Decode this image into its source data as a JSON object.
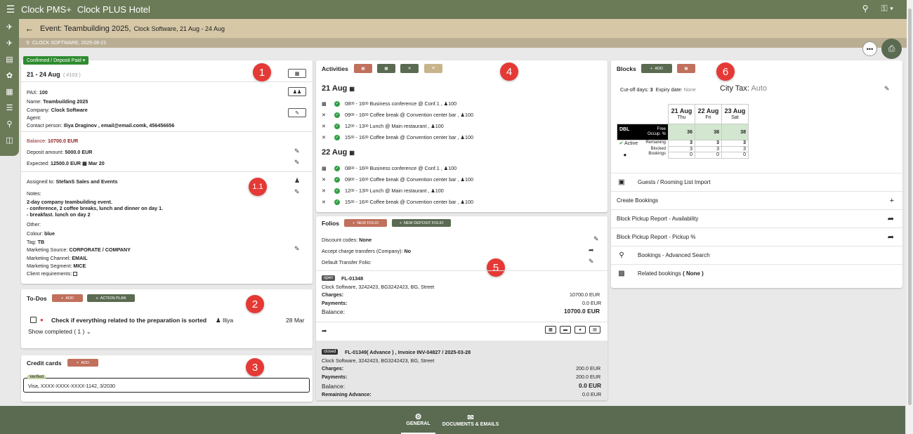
{
  "topbar": {
    "app_name": "Clock PMS+",
    "hotel_name": "Clock PLUS Hotel"
  },
  "event": {
    "title": "Event: Teambuilding 2025,",
    "subtitle": "Clock Software, 21 Aug - 24 Aug",
    "search_text": "CLOCK SOFTWARE, 2025-08-21"
  },
  "details": {
    "status": "Confirmed / Deposit Paid",
    "dates": "21 - 24 Aug",
    "ref": "( #103 )",
    "pax_label": "PAX:",
    "pax": "100",
    "name_label": "Name:",
    "name": "Teambuilding 2025",
    "company_label": "Company:",
    "company": "Clock Software",
    "agent_label": "Agent:",
    "contact_label": "Contact person:",
    "contact": "Iliya Draginov , email@email.comk, 456456656",
    "balance_label": "Balance:",
    "balance": "10700.0 EUR",
    "deposit_label": "Deposit amount:",
    "deposit": "5000.0 EUR",
    "expected_label": "Expected:",
    "expected": "12500.0 EUR",
    "expected_date": "Mar 20",
    "assigned_label": "Assigned to:",
    "assigned": "StefanS  Sales and Events",
    "notes_label": "Notes:",
    "notes_1": "2-day company teambuilding event.",
    "notes_2": "- conference, 2 coffee breaks, lunch and dinner on day 1.",
    "notes_3": "- breakfast. lunch on day 2",
    "other_label": "Other:",
    "colour_label": "Colour:",
    "colour": "blue",
    "tag_label": "Tag:",
    "tag": "TB",
    "msource_label": "Marketing Source:",
    "msource": "CORPORATE / COMPANY",
    "mchannel_label": "Marketing Channel:",
    "mchannel": "EMAIL",
    "msegment_label": "Marketing Segment:",
    "msegment": "MICE",
    "client_req_label": "Client requirements:"
  },
  "badges": {
    "b1": "1",
    "b11": "1.1",
    "b2": "2",
    "b3": "3",
    "b4": "4",
    "b5": "5",
    "b6": "6"
  },
  "todos": {
    "title": "To-Dos",
    "add": "ADD",
    "action_plan": "ACTION PLAN",
    "item": "Check if everything related to the preparation is sorted",
    "user": "Iliya",
    "date": "28 Mar",
    "show_completed": "Show completed ( 1 )"
  },
  "credit_cards": {
    "title": "Credit cards",
    "add": "ADD",
    "verified": "Verified",
    "card": "Visa, XXXX-XXXX-XXXX-1142, 3/2030"
  },
  "activities": {
    "title": "Activities",
    "days": [
      {
        "label": "21 Aug",
        "items": [
          {
            "t1": "08",
            "t2": "00",
            "t3": "16",
            "t4": "00",
            "desc": "Business conference @ Conf.1 ,",
            "pax": "100"
          },
          {
            "t1": "09",
            "t2": "00",
            "t3": "16",
            "t4": "00",
            "desc": "Coffee break @ Convention center bar ,",
            "pax": "100"
          },
          {
            "t1": "12",
            "t2": "00",
            "t3": "13",
            "t4": "00",
            "desc": "Lunch @ Main restaurant ,",
            "pax": "100"
          },
          {
            "t1": "15",
            "t2": "30",
            "t3": "16",
            "t4": "30",
            "desc": "Coffee break @ Convention center bar ,",
            "pax": "100"
          }
        ]
      },
      {
        "label": "22 Aug",
        "items": [
          {
            "t1": "08",
            "t2": "00",
            "t3": "16",
            "t4": "00",
            "desc": "Business conference @ Conf.1 ,",
            "pax": "100"
          },
          {
            "t1": "09",
            "t2": "00",
            "t3": "16",
            "t4": "00",
            "desc": "Coffee break @ Convention center bar ,",
            "pax": "100"
          },
          {
            "t1": "12",
            "t2": "00",
            "t3": "13",
            "t4": "00",
            "desc": "Lunch @ Main restaurant ,",
            "pax": "100"
          },
          {
            "t1": "15",
            "t2": "30",
            "t3": "16",
            "t4": "30",
            "desc": "Coffee break @ Convention center bar ,",
            "pax": "100"
          }
        ]
      }
    ]
  },
  "folios": {
    "title": "Folios",
    "new_folio": "NEW FOLIO",
    "new_deposit_folio": "NEW DEPOSIT FOLIO",
    "discount_label": "Discount codes:",
    "discount": "None",
    "accept_label": "Accept charge transfers (Company):",
    "accept": "No",
    "default_transfer_label": "Default Transfer Folio:",
    "f1": {
      "tag": "open",
      "id": "FL-01348",
      "address": "Clock Software, 3242423, BG3242423, BG, Street",
      "charges_label": "Charges:",
      "charges": "10700.0 EUR",
      "payments_label": "Payments:",
      "payments": "0.0 EUR",
      "balance_label": "Balance:",
      "balance": "10700.0 EUR"
    },
    "f2": {
      "tag": "closed",
      "id": "FL-01349( Advance ) , Invoice INV-04827 / 2025-03-28",
      "address": "Clock Software, 3242423, BG3242423, BG, Street",
      "charges_label": "Charges:",
      "charges": "200.0 EUR",
      "payments_label": "Payments:",
      "payments": "200.0 EUR",
      "balance_label": "Balance:",
      "balance": "0.0 EUR",
      "remaining_label": "Remaining Advance:",
      "remaining": "0.0 EUR"
    }
  },
  "blocks": {
    "title": "Blocks",
    "add": "ADD",
    "cutoff_label": "Cut-off days:",
    "cutoff": "3",
    "expiry_label": "Expiry date:",
    "expiry": "None",
    "city_tax_label": "City Tax:",
    "city_tax": "Auto",
    "dates": [
      {
        "d": "21 Aug",
        "w": "Thu"
      },
      {
        "d": "22 Aug",
        "w": "Fri"
      },
      {
        "d": "23 Aug",
        "w": "Sat"
      }
    ],
    "room_type": "DBL",
    "free_label": "Free",
    "occup_label": "Occup. %",
    "free": [
      "36",
      "38",
      "38"
    ],
    "active_label": "Active",
    "remaining_label": "Remaining",
    "blocked_label": "Blocked",
    "bookings_label": "Bookings",
    "remaining": [
      "3",
      "3",
      "3"
    ],
    "blocked": [
      "3",
      "3",
      "3"
    ],
    "bookings": [
      "0",
      "0",
      "0"
    ]
  },
  "right_menu": [
    {
      "label": "Guests / Rooming List Import"
    },
    {
      "label": "Create Bookings"
    },
    {
      "label": "Block Pickup Report - Availability"
    },
    {
      "label": "Block Pickup Report - Pickup %"
    },
    {
      "label": "Bookings - Advanced Search"
    },
    {
      "label": "Related bookings",
      "suffix": "( None )"
    }
  ],
  "bottom_tabs": {
    "general": "GENERAL",
    "docs": "DOCUMENTS & EMAILS"
  }
}
